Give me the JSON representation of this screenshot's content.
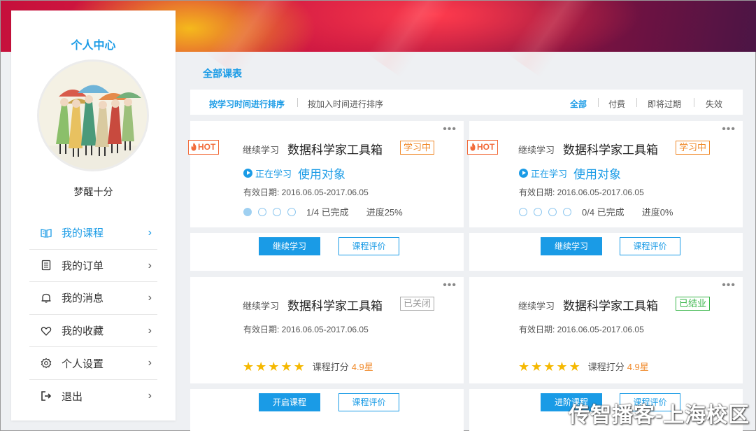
{
  "sidebar": {
    "title": "个人中心",
    "username": "梦醒十分",
    "items": [
      {
        "label": "我的课程",
        "icon": "book-icon",
        "active": true
      },
      {
        "label": "我的订单",
        "icon": "order-list-icon",
        "active": false
      },
      {
        "label": "我的消息",
        "icon": "bell-icon",
        "active": false
      },
      {
        "label": "我的收藏",
        "icon": "heart-icon",
        "active": false
      },
      {
        "label": "个人设置",
        "icon": "gear-icon",
        "active": false
      },
      {
        "label": "退出",
        "icon": "logout-icon",
        "active": false
      }
    ]
  },
  "main": {
    "section_title": "全部课表",
    "sort": {
      "by_study_time": "按学习时间进行排序",
      "by_join_time": "按加入时间进行排序"
    },
    "tabs": {
      "all": "全部",
      "paid": "付费",
      "expiring": "即将过期",
      "expired": "失效"
    }
  },
  "cards": [
    {
      "hot": "HOT",
      "continue_label": "继续学习",
      "course_name": "数据科学家工具箱",
      "status": "学习中",
      "learning_label": "正在学习",
      "target_label": "使用对象",
      "dates": "有效日期: 2016.06.05-2017.06.05",
      "progress_ratio": "1/4 已完成",
      "progress_pct": "进度25%",
      "progress_filled": 1,
      "primary_btn": "继续学习",
      "secondary_btn": "课程评价"
    },
    {
      "hot": "HOT",
      "continue_label": "继续学习",
      "course_name": "数据科学家工具箱",
      "status": "学习中",
      "learning_label": "正在学习",
      "target_label": "使用对象",
      "dates": "有效日期: 2016.06.05-2017.06.05",
      "progress_ratio": "0/4 已完成",
      "progress_pct": "进度0%",
      "progress_filled": 0,
      "primary_btn": "继续学习",
      "secondary_btn": "课程评价"
    },
    {
      "continue_label": "继续学习",
      "course_name": "数据科学家工具箱",
      "status": "已关闭",
      "dates": "有效日期: 2016.06.05-2017.06.05",
      "rating_label": "课程打分",
      "rating": "4.9星",
      "stars": 5,
      "primary_btn": "开启课程",
      "secondary_btn": "课程评价"
    },
    {
      "continue_label": "继续学习",
      "course_name": "数据科学家工具箱",
      "status": "已结业",
      "dates": "有效日期: 2016.06.05-2017.06.05",
      "rating_label": "课程打分",
      "rating": "4.9星",
      "stars": 5,
      "primary_btn": "进阶课程",
      "secondary_btn": "课程评价"
    }
  ],
  "watermark": "传智播客-上海校区",
  "colors": {
    "accent": "#1a9be6",
    "hot": "#f26b3a",
    "learning": "#f08a2b",
    "done": "#39b54a",
    "star": "#f5b800"
  }
}
